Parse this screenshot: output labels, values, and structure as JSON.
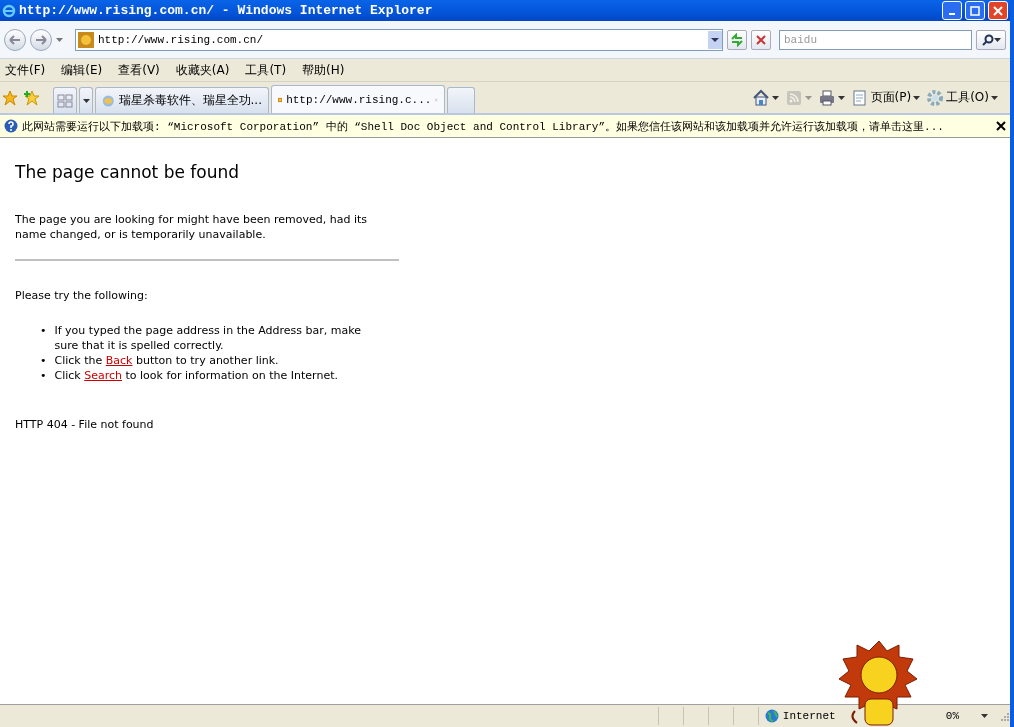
{
  "window": {
    "title": "http://www.rising.com.cn/ - Windows Internet Explorer"
  },
  "address_bar": {
    "value": "http://www.rising.com.cn/"
  },
  "search": {
    "placeholder": "baidu"
  },
  "menu": [
    "文件(F)",
    "编辑(E)",
    "查看(V)",
    "收藏夹(A)",
    "工具(T)",
    "帮助(H)"
  ],
  "tabs": [
    {
      "label": "瑞星杀毒软件、瑞星全功...",
      "selected": false
    },
    {
      "label": "http://www.rising.c...",
      "selected": true
    }
  ],
  "command_bar": [
    {
      "kind": "home",
      "disabled": false
    },
    {
      "kind": "feed",
      "disabled": true
    },
    {
      "kind": "print",
      "disabled": false
    },
    {
      "kind": "page",
      "label": "页面(P)",
      "disabled": false
    },
    {
      "kind": "tools",
      "label": "工具(O)",
      "disabled": false
    }
  ],
  "info_bar": {
    "message": "此网站需要运行以下加载项: “Microsoft Corporation” 中的 “Shell Doc Object and Control Library”。如果您信任该网站和该加载项并允许运行该加载项，请单击这里..."
  },
  "page": {
    "heading": "The page cannot be found",
    "intro": "The page you are looking for might have been removed, had its name changed, or is temporarily unavailable.",
    "prompt": "Please try the following:",
    "suggestions": [
      {
        "bullet": "•",
        "text": "If you typed the page address in the Address bar, make sure that it is spelled correctly."
      },
      {
        "bullet": "•",
        "before": "Click the ",
        "link": "Back",
        "after": " button to try another link."
      },
      {
        "bullet": "•",
        "before": "Click ",
        "link": "Search",
        "after": " to look for information on the Internet."
      }
    ],
    "error": "HTTP 404 - File not found"
  },
  "status_bar": {
    "zone": "Internet",
    "zoom": "0%"
  }
}
